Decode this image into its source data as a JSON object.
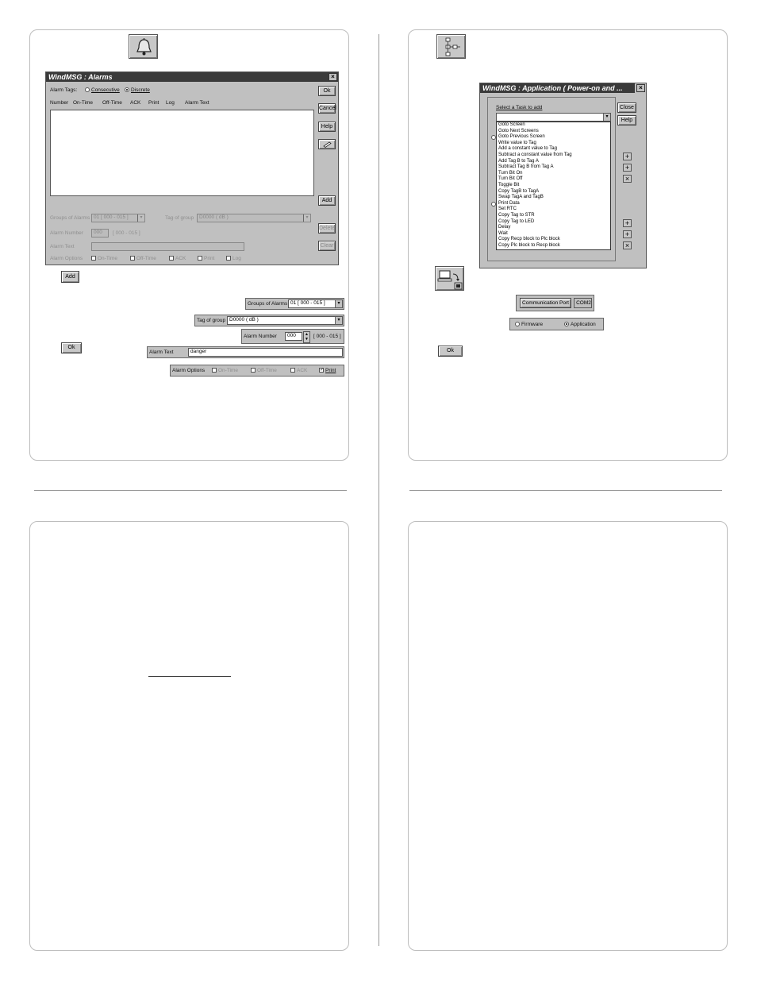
{
  "alarms_dialog": {
    "title": "WindMSG : Alarms",
    "close_glyph": "×",
    "alarm_tags_label": "Alarm Tags:",
    "option_consecutive": "Consecutive",
    "option_discrete": "Discrete",
    "columns": [
      "Number",
      "On-Time",
      "Off-Time",
      "ACK",
      "Print",
      "Log",
      "Alarm Text"
    ],
    "buttons": {
      "ok": "Ok",
      "cancel": "Cancel",
      "help": "Help",
      "add": "Add",
      "delete": "Delete",
      "clear": "Clear"
    },
    "disabled_group_label": "Groups of Alarms",
    "disabled_group_value": "01 [ 000 - 015 ]",
    "disabled_tag_label": "Tag of group",
    "disabled_tag_value": "D0000 ( dB )",
    "disabled_number_label": "Alarm Number",
    "disabled_number_value": "000",
    "disabled_number_range": "[ 000 - 015 ]",
    "disabled_text_label": "Alarm Text",
    "disabled_options_label": "Alarm Options",
    "disabled_options": [
      "On-Time",
      "Off-Time",
      "ACK",
      "Print",
      "Log"
    ]
  },
  "alarms_detail": {
    "add_button": "Add",
    "ok_button": "Ok",
    "groups_label": "Groups of Alarms",
    "groups_value": "01 [ 000 - 015 ]",
    "tag_label": "Tag of group",
    "tag_value": "D0000 ( dB )",
    "number_label": "Alarm Number",
    "number_value": "000",
    "number_range": "[ 000 - 015 ]",
    "text_label": "Alarm Text",
    "text_value": "danger",
    "options_label": "Alarm Options",
    "options": [
      "On-Time",
      "Off-Time",
      "ACK",
      "Print"
    ],
    "options_active": "Print"
  },
  "app_dialog": {
    "title": "WindMSG : Application ( Power-on and ...",
    "close_glyph": "×",
    "select_label": "Select a Task to add",
    "close_button": "Close",
    "help_button": "Help",
    "tasks": [
      "Goto Screen",
      "Goto Next Screens",
      "Goto Previous Screen",
      "Write value to Tag",
      "Add a constant value to Tag",
      "Subtract a constant value from Tag",
      "Add Tag B to Tag A",
      "Subtract Tag B from Tag A",
      "Turn Bit On",
      "Turn Bit Off",
      "Toggle Bit",
      "Copy TagB to TagA",
      "Swap TagA and TagB",
      "Print Data",
      "Set RTC",
      "Copy Tag to STR",
      "Copy Tag to LED",
      "Delay",
      "Wait",
      "Copy Recp block to Plc block",
      "Copy Plc block to Recp block"
    ],
    "side_glyphs": [
      "+",
      "+",
      "×",
      "+",
      "+",
      "×"
    ]
  },
  "comm_detail": {
    "port_button": "Communication Port",
    "port_value": "COM2",
    "firmware_label": "Firmware",
    "application_label": "Application",
    "ok_button": "Ok"
  },
  "icons": {
    "alarm_bell": "bell-icon",
    "tasks_tree": "tree-icon",
    "download_pc": "pc-download-icon"
  }
}
